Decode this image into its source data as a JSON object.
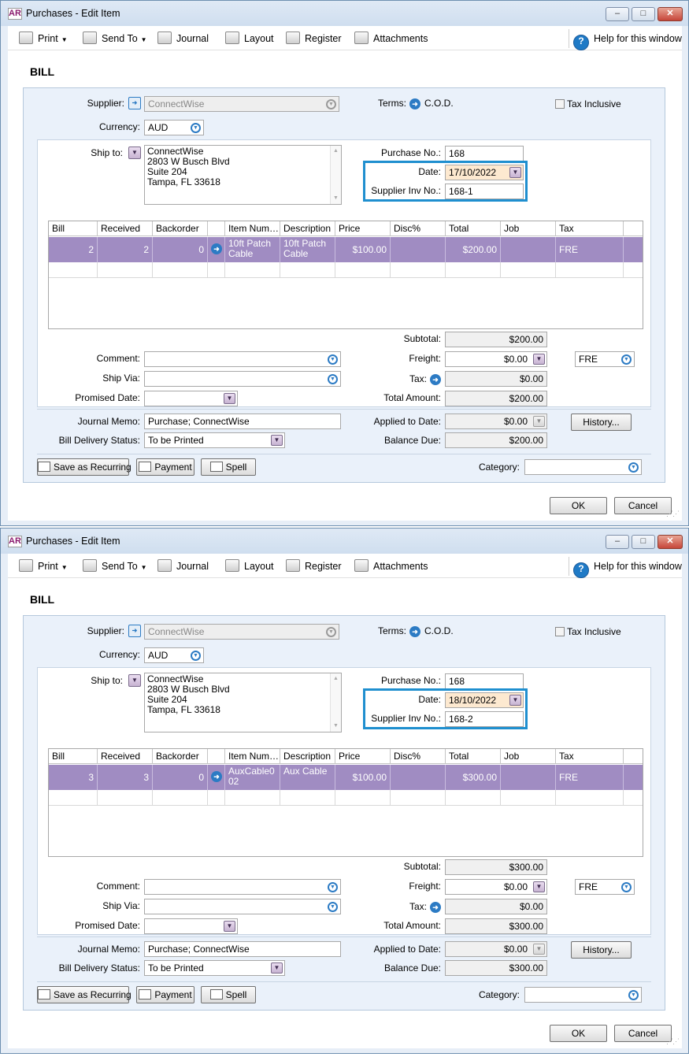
{
  "windows": [
    {
      "app_logo": "AR",
      "title": "Purchases - Edit Item",
      "controls": {
        "minimize": "–",
        "maximize": "□",
        "close": "✕"
      },
      "toolbar": {
        "print": "Print",
        "send_to": "Send To",
        "journal": "Journal",
        "layout": "Layout",
        "register": "Register",
        "attachments": "Attachments",
        "help": "Help for this window"
      },
      "heading": "BILL",
      "supplier_label": "Supplier:",
      "supplier_value": "ConnectWise",
      "terms_label": "Terms:",
      "terms_value": "C.O.D.",
      "tax_inclusive_label": "Tax Inclusive",
      "currency_label": "Currency:",
      "currency_value": "AUD",
      "ship_to_label": "Ship to:",
      "ship_to_lines": [
        "ConnectWise",
        "2803 W Busch Blvd",
        "Suite 204",
        "Tampa, FL 33618"
      ],
      "purchase_no_label": "Purchase No.:",
      "purchase_no_value": "168",
      "date_label": "Date:",
      "date_value": "17/10/2022",
      "supplier_inv_label": "Supplier Inv No.:",
      "supplier_inv_value": "168-1",
      "columns": [
        "Bill",
        "Received",
        "Backorder",
        "",
        "Item Num…",
        "Description",
        "Price",
        "Disc%",
        "Total",
        "Job",
        "Tax"
      ],
      "row": {
        "bill": "2",
        "received": "2",
        "backorder": "0",
        "item_num": "10ft Patch Cable",
        "description": "10ft Patch Cable",
        "price": "$100.00",
        "disc": "",
        "total": "$200.00",
        "job": "",
        "tax": "FRE"
      },
      "subtotal_label": "Subtotal:",
      "subtotal_value": "$200.00",
      "comment_label": "Comment:",
      "freight_label": "Freight:",
      "freight_value": "$0.00",
      "freight_tax": "FRE",
      "ship_via_label": "Ship Via:",
      "tax_label": "Tax:",
      "tax_value": "$0.00",
      "promised_label": "Promised Date:",
      "total_amount_label": "Total Amount:",
      "total_amount_value": "$200.00",
      "journal_memo_label": "Journal Memo:",
      "journal_memo_value": "Purchase; ConnectWise",
      "applied_label": "Applied to Date:",
      "applied_value": "$0.00",
      "history_button": "History...",
      "delivery_label": "Bill Delivery Status:",
      "delivery_value": "To be Printed",
      "balance_label": "Balance Due:",
      "balance_value": "$200.00",
      "save_recurring_button": "Save as Recurring",
      "payment_button": "Payment",
      "spell_button": "Spell",
      "category_label": "Category:",
      "ok_button": "OK",
      "cancel_button": "Cancel"
    },
    {
      "app_logo": "AR",
      "title": "Purchases - Edit Item",
      "controls": {
        "minimize": "–",
        "maximize": "□",
        "close": "✕"
      },
      "toolbar": {
        "print": "Print",
        "send_to": "Send To",
        "journal": "Journal",
        "layout": "Layout",
        "register": "Register",
        "attachments": "Attachments",
        "help": "Help for this window"
      },
      "heading": "BILL",
      "supplier_label": "Supplier:",
      "supplier_value": "ConnectWise",
      "terms_label": "Terms:",
      "terms_value": "C.O.D.",
      "tax_inclusive_label": "Tax Inclusive",
      "currency_label": "Currency:",
      "currency_value": "AUD",
      "ship_to_label": "Ship to:",
      "ship_to_lines": [
        "ConnectWise",
        "2803 W Busch Blvd",
        "Suite 204",
        "Tampa, FL 33618"
      ],
      "purchase_no_label": "Purchase No.:",
      "purchase_no_value": "168",
      "date_label": "Date:",
      "date_value": "18/10/2022",
      "supplier_inv_label": "Supplier Inv No.:",
      "supplier_inv_value": "168-2",
      "columns": [
        "Bill",
        "Received",
        "Backorder",
        "",
        "Item Num…",
        "Description",
        "Price",
        "Disc%",
        "Total",
        "Job",
        "Tax"
      ],
      "row": {
        "bill": "3",
        "received": "3",
        "backorder": "0",
        "item_num": "AuxCable002",
        "description": "Aux Cable",
        "price": "$100.00",
        "disc": "",
        "total": "$300.00",
        "job": "",
        "tax": "FRE"
      },
      "subtotal_label": "Subtotal:",
      "subtotal_value": "$300.00",
      "comment_label": "Comment:",
      "freight_label": "Freight:",
      "freight_value": "$0.00",
      "freight_tax": "FRE",
      "ship_via_label": "Ship Via:",
      "tax_label": "Tax:",
      "tax_value": "$0.00",
      "promised_label": "Promised Date:",
      "total_amount_label": "Total Amount:",
      "total_amount_value": "$300.00",
      "journal_memo_label": "Journal Memo:",
      "journal_memo_value": "Purchase; ConnectWise",
      "applied_label": "Applied to Date:",
      "applied_value": "$0.00",
      "history_button": "History...",
      "delivery_label": "Bill Delivery Status:",
      "delivery_value": "To be Printed",
      "balance_label": "Balance Due:",
      "balance_value": "$300.00",
      "save_recurring_button": "Save as Recurring",
      "payment_button": "Payment",
      "spell_button": "Spell",
      "category_label": "Category:",
      "ok_button": "OK",
      "cancel_button": "Cancel"
    }
  ]
}
